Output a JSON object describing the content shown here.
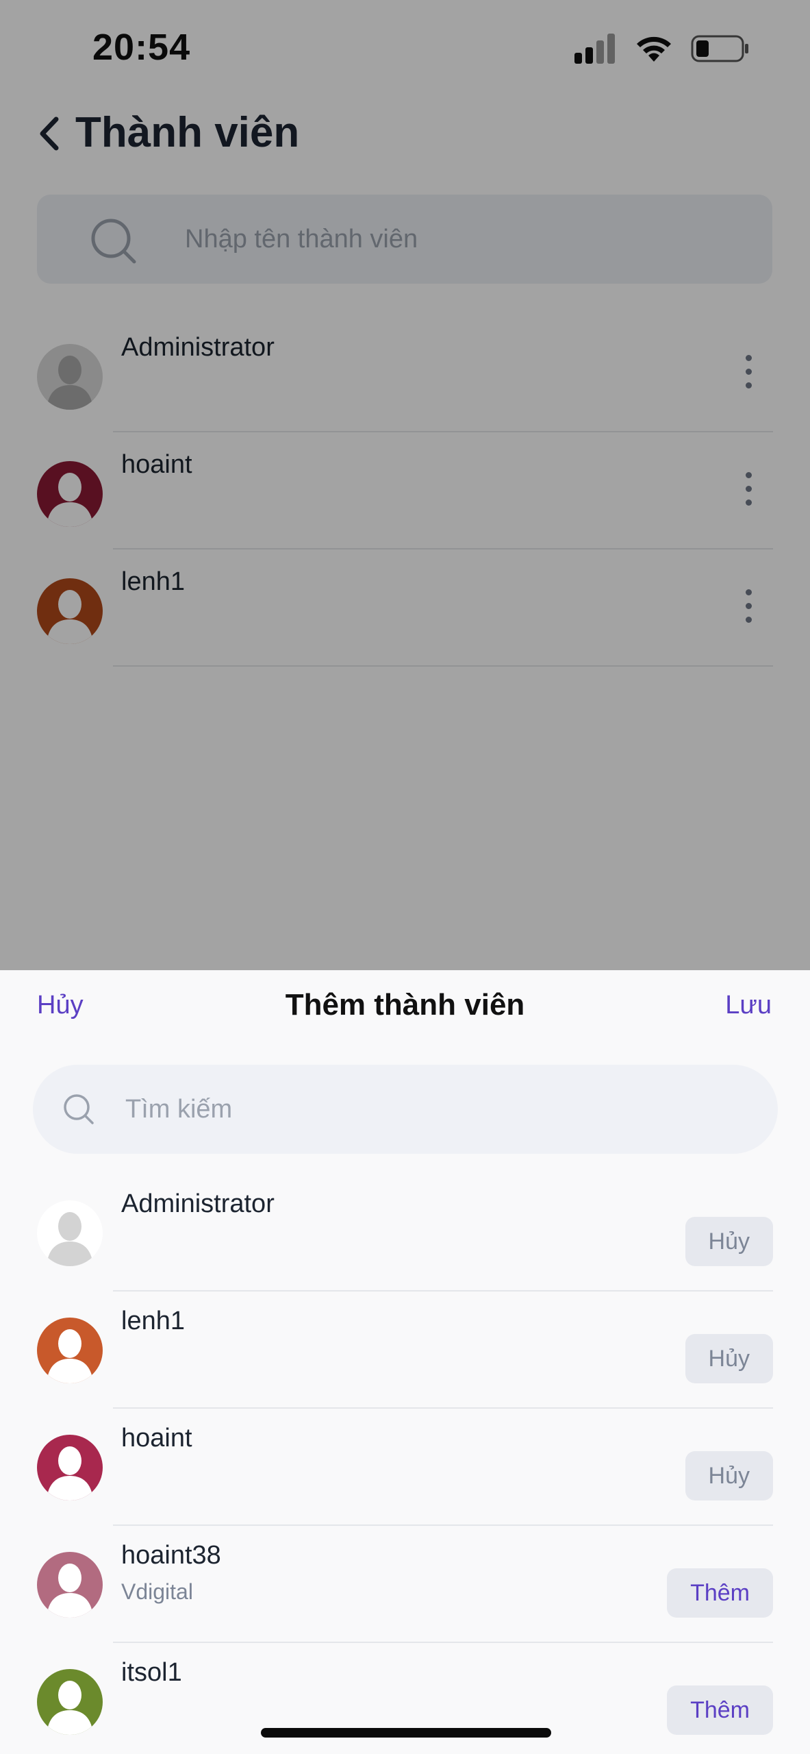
{
  "status_bar": {
    "time": "20:54",
    "icons": [
      "signal-icon",
      "wifi-icon",
      "battery-icon"
    ]
  },
  "header": {
    "title": "Thành viên",
    "back_icon": "chevron-left-icon"
  },
  "member_search": {
    "placeholder": "Nhập tên thành viên",
    "icon": "search-icon"
  },
  "members": [
    {
      "name": "Administrator",
      "avatar_color": "#d8d8d8",
      "figure_color": "#a9a9a9"
    },
    {
      "name": "hoaint",
      "avatar_color": "#8a1a35",
      "figure_color": "#ffffff"
    },
    {
      "name": "lenh1",
      "avatar_color": "#b0481a",
      "figure_color": "#ffffff"
    }
  ],
  "sheet": {
    "title": "Thêm thành viên",
    "cancel_label": "Hủy",
    "save_label": "Lưu",
    "search_placeholder": "Tìm kiếm"
  },
  "candidates": [
    {
      "name": "Administrator",
      "subtitle": "",
      "action": "Hủy",
      "added": true,
      "avatar_color": "#ffffff",
      "figure_color": "#d3d3d3"
    },
    {
      "name": "lenh1",
      "subtitle": "",
      "action": "Hủy",
      "added": true,
      "avatar_color": "#c8592b",
      "figure_color": "#ffffff"
    },
    {
      "name": "hoaint",
      "subtitle": "",
      "action": "Hủy",
      "added": true,
      "avatar_color": "#a8284e",
      "figure_color": "#ffffff"
    },
    {
      "name": "hoaint38",
      "subtitle": "Vdigital",
      "action": "Thêm",
      "added": false,
      "avatar_color": "#b26b80",
      "figure_color": "#ffffff"
    },
    {
      "name": "itsol1",
      "subtitle": "",
      "action": "Thêm",
      "added": false,
      "avatar_color": "#6b8a2c",
      "figure_color": "#ffffff"
    }
  ],
  "colors": {
    "accent": "#5b3fc4",
    "overlay": "rgba(0,0,0,0.36)"
  }
}
